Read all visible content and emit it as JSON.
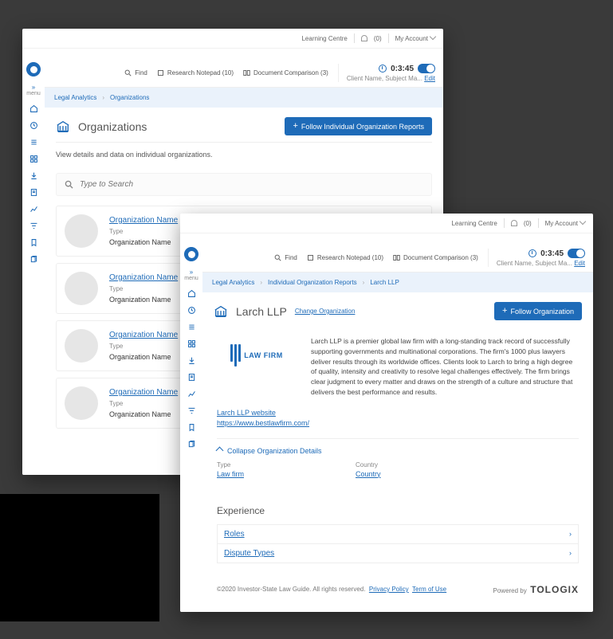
{
  "topbar": {
    "learning_centre": "Learning Centre",
    "notif_count": "(0)",
    "my_account": "My Account"
  },
  "toolbar": {
    "find": "Find",
    "research_notepad": "Research Notepad (10)",
    "doc_compare": "Document Comparison (3)",
    "timer": "0:3:45",
    "client": "Client Name, Subject Ma...",
    "edit": "Edit"
  },
  "sidebar": {
    "menu": "menu",
    "expand": "»"
  },
  "win1": {
    "crumbs": {
      "a": "Legal Analytics",
      "b": "Organizations"
    },
    "title": "Organizations",
    "follow": "Follow Individual Organization Reports",
    "subtitle": "View details and data on individual organizations.",
    "search_placeholder": "Type to Search",
    "card": {
      "name": "Organization Name",
      "type_label": "Type",
      "type_value": "Organization Name"
    }
  },
  "win2": {
    "crumbs": {
      "a": "Legal Analytics",
      "b": "Individual Organization Reports",
      "c": "Larch LLP"
    },
    "title": "Larch LLP",
    "change": "Change Organization",
    "follow": "Follow Organization",
    "firm_label": "LAW FIRM",
    "desc": "Larch LLP is a premier global law firm with a long-standing track record of successfully supporting governments and multinational corporations. The firm's 1000 plus lawyers deliver results through its worldwide offices. Clients look to Larch to bring a high degree of quality, intensity and creativity to resolve legal challenges effectively. The firm brings clear judgment to every matter and draws on the strength of a culture and structure that delivers the best performance and results.",
    "link_label": "Larch LLP website",
    "link_url": "https://www.bestlawfirm.com/",
    "collapse": "Collapse Organization Details",
    "type_label": "Type",
    "type_value": "Law firm",
    "country_label": "Country",
    "country_value": "Country",
    "experience": "Experience",
    "roles": "Roles",
    "dispute_types": "Dispute Types",
    "copyright": "©2020 Investor-State Law Guide. All rights reserved.",
    "privacy": "Privacy Policy",
    "terms": "Term of Use",
    "powered": "Powered by",
    "brand": "TOLOGIX"
  }
}
